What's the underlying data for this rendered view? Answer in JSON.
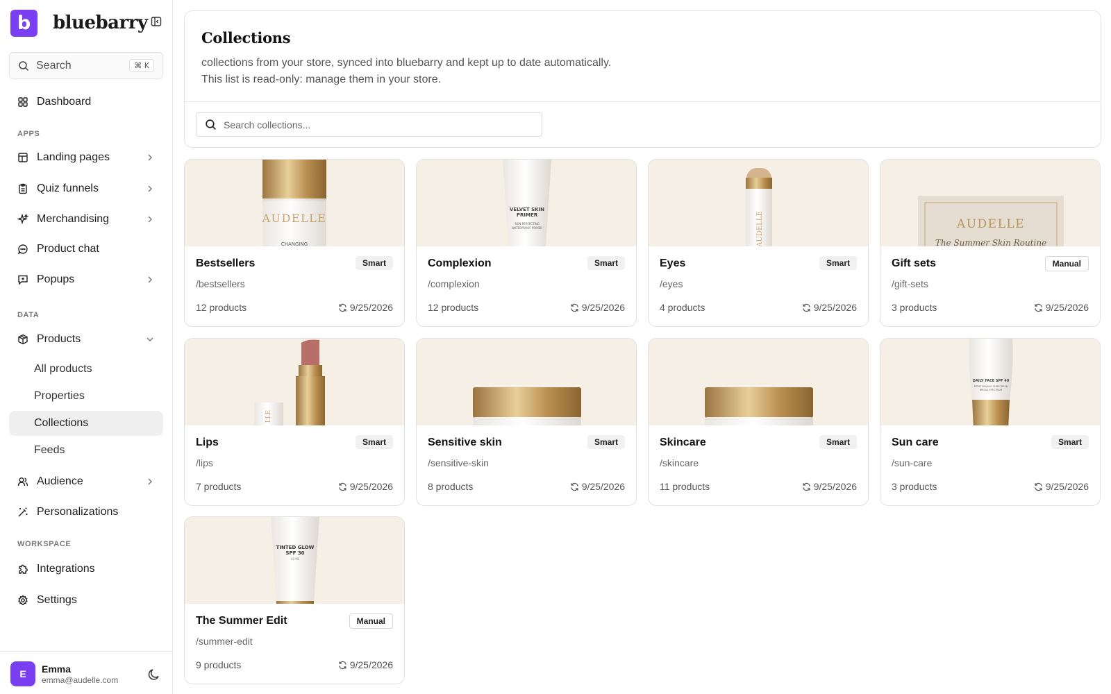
{
  "brand": {
    "logo_letter": "b",
    "name": "bluebarry"
  },
  "search": {
    "label": "Search",
    "shortcut": "⌘ K"
  },
  "nav": {
    "dashboard": "Dashboard",
    "apps_label": "APPS",
    "landing_pages": "Landing pages",
    "quiz_funnels": "Quiz funnels",
    "merchandising": "Merchandising",
    "product_chat": "Product chat",
    "popups": "Popups",
    "data_label": "DATA",
    "products": "Products",
    "products_sub": [
      "All products",
      "Properties",
      "Collections",
      "Feeds"
    ],
    "audience": "Audience",
    "personalizations": "Personalizations",
    "workspace_label": "WORKSPACE",
    "integrations": "Integrations",
    "settings": "Settings"
  },
  "user": {
    "initial": "E",
    "name": "Emma",
    "email": "emma@audelle.com"
  },
  "header": {
    "title": "Collections",
    "description_line1": "collections from your store, synced into bluebarry and kept up to date automatically.",
    "description_line2": "This list is read-only: manage them in your store.",
    "search_placeholder": "Search collections..."
  },
  "collections": [
    {
      "name": "Bestsellers",
      "type": "Smart",
      "handle": "/bestsellers",
      "count": "12 products",
      "synced": "9/25/2026",
      "image": "foundation-bottle",
      "image_text": "AUDELLE",
      "image_subtext": "CHANGING"
    },
    {
      "name": "Complexion",
      "type": "Smart",
      "handle": "/complexion",
      "count": "12 products",
      "synced": "9/25/2026",
      "image": "primer-tube",
      "image_text": "VELVET SKIN PRIMER",
      "image_subtext": "SKIN PERFECTING WATERPROOF PRIMER"
    },
    {
      "name": "Eyes",
      "type": "Smart",
      "handle": "/eyes",
      "count": "4 products",
      "synced": "9/25/2026",
      "image": "eye-pencil",
      "image_text": "AUDELLE"
    },
    {
      "name": "Gift sets",
      "type": "Manual",
      "handle": "/gift-sets",
      "count": "3 products",
      "synced": "9/25/2026",
      "image": "gift-box",
      "image_text": "AUDELLE",
      "image_subtext": "The Summer Skin Routine"
    },
    {
      "name": "Lips",
      "type": "Smart",
      "handle": "/lips",
      "count": "7 products",
      "synced": "9/25/2026",
      "image": "lipstick",
      "image_text": "LLE"
    },
    {
      "name": "Sensitive skin",
      "type": "Smart",
      "handle": "/sensitive-skin",
      "count": "8 products",
      "synced": "9/25/2026",
      "image": "cream-jar"
    },
    {
      "name": "Skincare",
      "type": "Smart",
      "handle": "/skincare",
      "count": "11 products",
      "synced": "9/25/2026",
      "image": "cream-jar"
    },
    {
      "name": "Sun care",
      "type": "Smart",
      "handle": "/sun-care",
      "count": "3 products",
      "synced": "9/25/2026",
      "image": "sunscreen-tube",
      "image_text": "DAILY FACE SPF 40",
      "image_subtext": "MOISTURIZING SUNSCREEN BROAD SPECTRUM"
    },
    {
      "name": "The Summer Edit",
      "type": "Manual",
      "handle": "/summer-edit",
      "count": "9 products",
      "synced": "9/25/2026",
      "image": "tinted-tube",
      "image_text": "TINTED GLOW SPF 30",
      "image_subtext": "40 ML"
    }
  ],
  "colors": {
    "accent": "#7a3ff2",
    "card_image_bg": "#f6efe6",
    "gold": "#c19a5b"
  }
}
